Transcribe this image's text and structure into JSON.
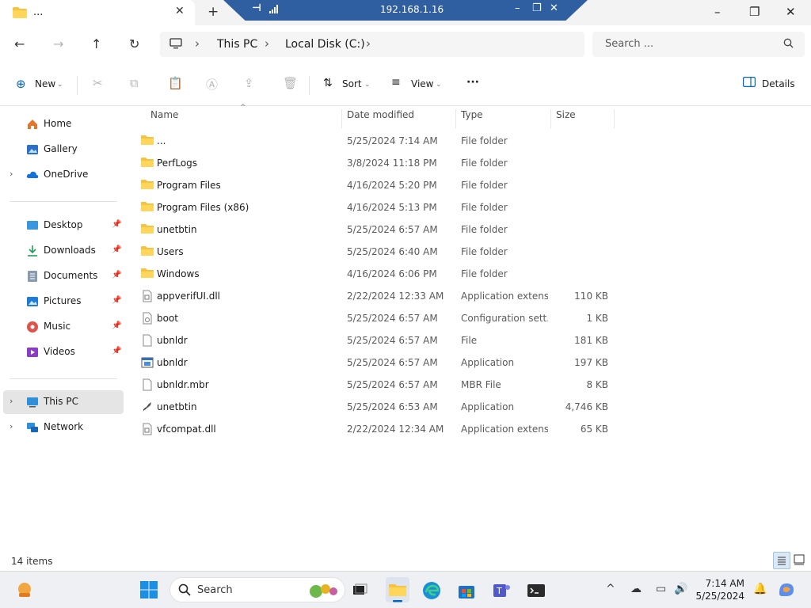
{
  "window": {
    "tab_title": "...",
    "remote_ip": "192.168.1.16"
  },
  "breadcrumb": [
    "This PC",
    "Local Disk (C:)"
  ],
  "search": {
    "placeholder": "Search ..."
  },
  "toolbar": {
    "new_label": "New",
    "sort_label": "Sort",
    "view_label": "View",
    "more_label": "···",
    "details_label": "Details"
  },
  "sidebar": {
    "top": [
      {
        "label": "Home",
        "icon": "home-icon",
        "expand": false
      },
      {
        "label": "Gallery",
        "icon": "gallery-icon",
        "expand": false
      },
      {
        "label": "OneDrive",
        "icon": "cloud-icon",
        "expand": true
      }
    ],
    "quick": [
      {
        "label": "Desktop",
        "icon": "desktop-icon"
      },
      {
        "label": "Downloads",
        "icon": "download-icon"
      },
      {
        "label": "Documents",
        "icon": "documents-icon"
      },
      {
        "label": "Pictures",
        "icon": "pictures-icon"
      },
      {
        "label": "Music",
        "icon": "music-icon"
      },
      {
        "label": "Videos",
        "icon": "videos-icon"
      }
    ],
    "bottom": [
      {
        "label": "This PC",
        "icon": "this-pc-icon",
        "selected": true
      },
      {
        "label": "Network",
        "icon": "network-icon",
        "selected": false
      }
    ]
  },
  "columns": {
    "name": "Name",
    "date": "Date modified",
    "type": "Type",
    "size": "Size"
  },
  "files": [
    {
      "name": "...",
      "date": "5/25/2024 7:14 AM",
      "type": "File folder",
      "size": "",
      "icon": "folder-icon"
    },
    {
      "name": "PerfLogs",
      "date": "3/8/2024 11:18 PM",
      "type": "File folder",
      "size": "",
      "icon": "folder-icon"
    },
    {
      "name": "Program Files",
      "date": "4/16/2024 5:20 PM",
      "type": "File folder",
      "size": "",
      "icon": "folder-icon"
    },
    {
      "name": "Program Files (x86)",
      "date": "4/16/2024 5:13 PM",
      "type": "File folder",
      "size": "",
      "icon": "folder-icon"
    },
    {
      "name": "unetbtin",
      "date": "5/25/2024 6:57 AM",
      "type": "File folder",
      "size": "",
      "icon": "folder-icon"
    },
    {
      "name": "Users",
      "date": "5/25/2024 6:40 AM",
      "type": "File folder",
      "size": "",
      "icon": "folder-icon"
    },
    {
      "name": "Windows",
      "date": "4/16/2024 6:06 PM",
      "type": "File folder",
      "size": "",
      "icon": "folder-icon"
    },
    {
      "name": "appverifUI.dll",
      "date": "2/22/2024 12:33 AM",
      "type": "Application extens...",
      "size": "110 KB",
      "icon": "dll-file-icon"
    },
    {
      "name": "boot",
      "date": "5/25/2024 6:57 AM",
      "type": "Configuration sett...",
      "size": "1 KB",
      "icon": "config-file-icon"
    },
    {
      "name": "ubnldr",
      "date": "5/25/2024 6:57 AM",
      "type": "File",
      "size": "181 KB",
      "icon": "file-icon"
    },
    {
      "name": "ubnldr",
      "date": "5/25/2024 6:57 AM",
      "type": "Application",
      "size": "197 KB",
      "icon": "application-icon"
    },
    {
      "name": "ubnldr.mbr",
      "date": "5/25/2024 6:57 AM",
      "type": "MBR File",
      "size": "8 KB",
      "icon": "file-icon"
    },
    {
      "name": "unetbtin",
      "date": "5/25/2024 6:53 AM",
      "type": "Application",
      "size": "4,746 KB",
      "icon": "unetbootin-app-icon"
    },
    {
      "name": "vfcompat.dll",
      "date": "2/22/2024 12:34 AM",
      "type": "Application extens...",
      "size": "65 KB",
      "icon": "dll-file-icon"
    }
  ],
  "status": {
    "item_count": "14 items"
  },
  "taskbar": {
    "search_label": "Search",
    "time": "7:14 AM",
    "date": "5/25/2024"
  },
  "colors": {
    "accent": "#0067c0",
    "folder": "#f5c241",
    "selected": "#e5e5e5",
    "remote_bar": "#2f5fa0"
  }
}
